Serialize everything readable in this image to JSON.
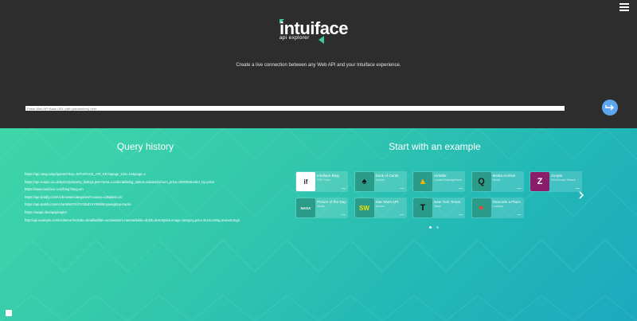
{
  "header": {
    "logo_text": "intuiface",
    "logo_sub": "api explorer",
    "tagline": "Create a live connection between any Web API and your Intuiface experience."
  },
  "search": {
    "placeholder": "Paste Web API Base URL (with parameters) here"
  },
  "query_history": {
    "title": "Query history",
    "items": [
      "https://api.rawg.io/api/games?key=INTUIFACE_API_KEY&page_size=12&page=1",
      "https://api.zoopla.co.uk/api/v1/property_listings.json?area=London&listing_status=sale&minimum_price=300000&order_by=price",
      "https://www.intuiface.com/blog?lang=en",
      "https://api.spotify.com/v1/browse/categories?country=US&limit=20",
      "https://api.spotify.com/v1/artists/0TnOYISbd1XYRBk9myaseg/top-tracks",
      "https://swapi.dev/api/people/",
      "http://api.example.com/v1/items?include=details&filter=active&sort=name&fields=id,title,description,image,category,price,stock,rating,reviews,tags"
    ]
  },
  "examples": {
    "title": "Start with an example",
    "cards": [
      {
        "title": "Intuiface Blog",
        "sub": "RSS Feed",
        "icon": "if",
        "color": "#ffffff",
        "fg": "#1a1a1a"
      },
      {
        "title": "Deck of Cards",
        "sub": "Games",
        "icon": "♠",
        "color": "#2b9b8a",
        "fg": "#111111"
      },
      {
        "title": "Airtable",
        "sub": "Content Management",
        "icon": "▲",
        "color": "#2b9b8a",
        "fg": "#fcb400"
      },
      {
        "title": "Media Archive",
        "sub": "Media",
        "icon": "Q",
        "color": "#2b9b8a",
        "fg": "#1a1a1a"
      },
      {
        "title": "Zoopla",
        "sub": "Real Estate Search",
        "icon": "Z",
        "color": "#8a1e6b",
        "fg": "#ffffff"
      },
      {
        "title": "Picture of the Day",
        "sub": "Media",
        "icon": "NASA",
        "color": "#2b9b8a",
        "fg": "#ffffff"
      },
      {
        "title": "Star Wars API",
        "sub": "Movies",
        "icon": "SW",
        "color": "#2b9b8a",
        "fg": "#f5e000"
      },
      {
        "title": "New York Times",
        "sub": "News",
        "icon": "T",
        "color": "#2b9b8a",
        "fg": "#111111"
      },
      {
        "title": "Geocode a Place",
        "sub": "Location",
        "icon": "●",
        "color": "#2b9b8a",
        "fg": "#e84335"
      }
    ],
    "link_label": "⟶",
    "page_count": 2,
    "active_page": 1
  },
  "colors": {
    "accent": "#40c9a2",
    "go_button": "#5ea7ee"
  }
}
